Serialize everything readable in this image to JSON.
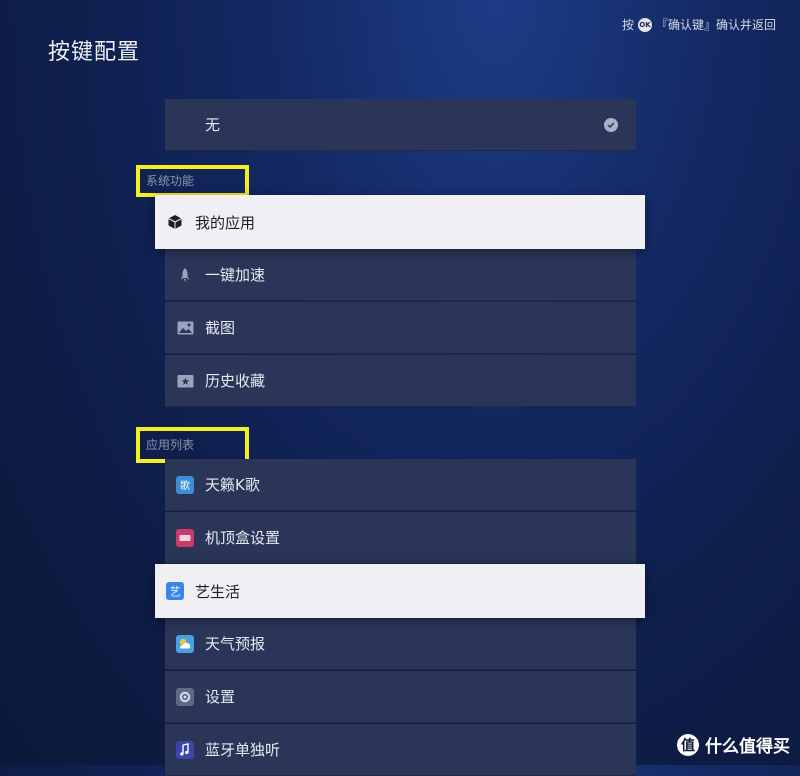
{
  "page": {
    "title": "按键配置"
  },
  "hint": {
    "prefix": "按",
    "ok_badge": "OK",
    "suffix": "『确认键』确认并返回"
  },
  "none_option": {
    "label": "无"
  },
  "system_section": {
    "header": "系统功能",
    "items": [
      {
        "label": "我的应用",
        "icon": "cube-icon",
        "selected": true
      },
      {
        "label": "一键加速",
        "icon": "rocket-icon"
      },
      {
        "label": "截图",
        "icon": "image-icon"
      },
      {
        "label": "历史收藏",
        "icon": "star-folder-icon"
      }
    ]
  },
  "app_section": {
    "header": "应用列表",
    "items": [
      {
        "label": "天籁K歌",
        "icon": "karaoke-app-icon",
        "icon_color": "#3b8fd6"
      },
      {
        "label": "机顶盒设置",
        "icon": "settop-box-app-icon",
        "icon_color": "#c93b6b"
      },
      {
        "label": "艺生活",
        "icon": "art-life-app-icon",
        "icon_color": "#3a86e8",
        "selected": true
      },
      {
        "label": "天气预报",
        "icon": "weather-app-icon",
        "icon_color": "#4aa0e0"
      },
      {
        "label": "设置",
        "icon": "settings-app-icon",
        "icon_color": "#5f6a86"
      },
      {
        "label": "蓝牙单独听",
        "icon": "bluetooth-music-app-icon",
        "icon_color": "#3b46a8"
      }
    ]
  },
  "watermark": {
    "mark": "值",
    "text": "什么值得买"
  }
}
